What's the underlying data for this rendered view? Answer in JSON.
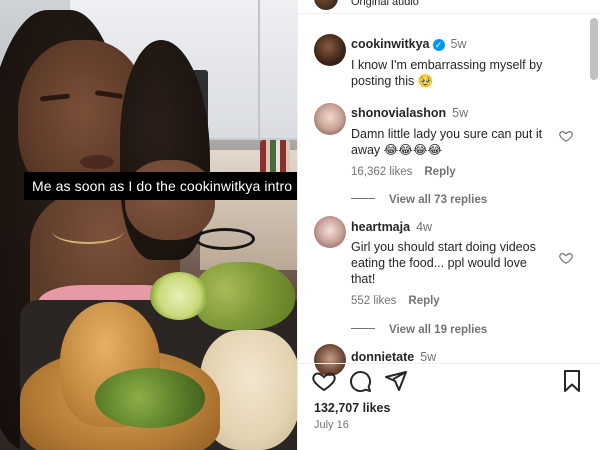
{
  "video": {
    "caption": "Me as soon as I do the cookinwitkya intro"
  },
  "audio": {
    "label": "Original audio"
  },
  "post": {
    "author": "cookinwitkya",
    "time": "5w",
    "caption_line1": "I know I'm embarrassing myself by",
    "caption_line2": "posting this 🥹"
  },
  "comments": [
    {
      "user": "shonovialashon",
      "time": "5w",
      "text_line1": "Damn little lady you sure can put it",
      "text_line2": "away 😂😂😂😂",
      "likes": "16,362 likes",
      "reply": "Reply",
      "view_replies": "View all 73 replies"
    },
    {
      "user": "heartmaja",
      "time": "4w",
      "text_line1": "Girl you should start doing videos",
      "text_line2": "eating the food... ppl would love",
      "text_line3": "that!",
      "likes": "552 likes",
      "reply": "Reply",
      "view_replies": "View all 19 replies"
    },
    {
      "user": "donnietate",
      "time": "5w"
    }
  ],
  "footer": {
    "likes": "132,707 likes",
    "date": "July 16"
  },
  "icons": {
    "like": "heart-icon",
    "comment": "comment-icon",
    "share": "share-icon",
    "save": "bookmark-icon",
    "verified": "verified-badge-icon"
  },
  "colors": {
    "verified": "#0095f6",
    "text": "#262626",
    "muted": "#737373",
    "caption_bg": "#000000"
  }
}
